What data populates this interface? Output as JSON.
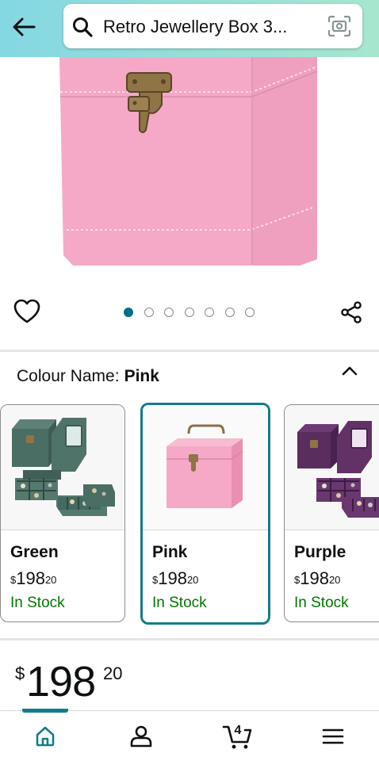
{
  "header": {
    "search_query": "Retro Jewellery Box 3...",
    "gradient_start": "#84d8e3",
    "gradient_end": "#a6e6ce"
  },
  "product_image": {
    "total_images": 7,
    "current_index": 0,
    "box_color": "#f5a9c6"
  },
  "variation": {
    "label": "Colour Name:",
    "selected_value": "Pink",
    "options": [
      {
        "name": "Green",
        "currency": "$",
        "price_whole": "198",
        "price_fraction": "20",
        "stock": "In Stock",
        "selected": false
      },
      {
        "name": "Pink",
        "currency": "$",
        "price_whole": "198",
        "price_fraction": "20",
        "stock": "In Stock",
        "selected": true
      },
      {
        "name": "Purple",
        "currency": "$",
        "price_whole": "198",
        "price_fraction": "20",
        "stock": "In Stock",
        "selected": false
      }
    ]
  },
  "price": {
    "currency": "$",
    "whole": "198",
    "fraction": "20"
  },
  "bottom_nav": {
    "items": [
      "home-icon",
      "account-icon",
      "cart-icon",
      "menu-icon"
    ],
    "active": "home-icon",
    "cart_count": "4"
  },
  "colors": {
    "accent": "#137c8b",
    "in_stock": "#007600",
    "dot_active": "#007185"
  }
}
